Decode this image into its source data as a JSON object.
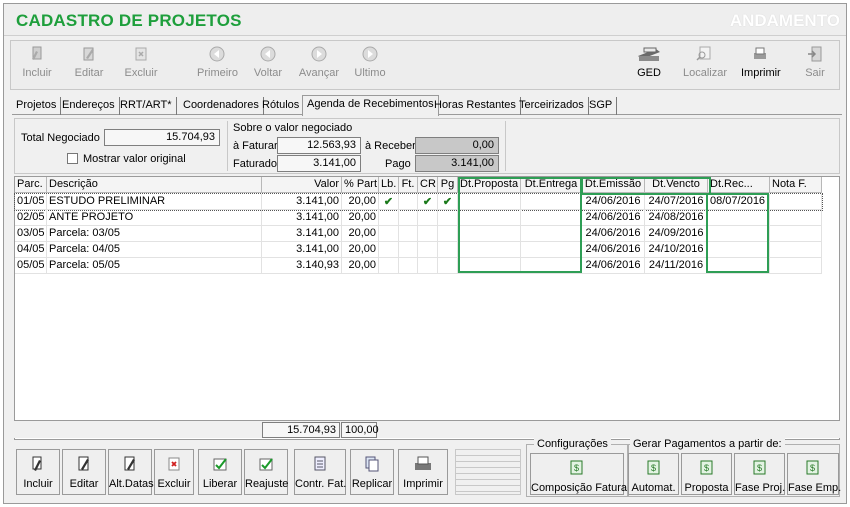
{
  "window": {
    "title": "CADASTRO DE PROJETOS",
    "status": "ANDAMENTO"
  },
  "toolbar": {
    "incluir": "Incluir",
    "editar": "Editar",
    "excluir": "Excluir",
    "primeiro": "Primeiro",
    "voltar": "Voltar",
    "avancar": "Avançar",
    "ultimo": "Ultimo",
    "ged": "GED",
    "localizar": "Localizar",
    "imprimir": "Imprimir",
    "sair": "Sair"
  },
  "tabs": [
    "Projetos",
    "Endereços",
    "RRT/ART*",
    "Coordenadores",
    "Rótulos",
    "Agenda de Recebimentos",
    "Horas Restantes",
    "Terceirizados",
    "SGP"
  ],
  "summary": {
    "total_negociado_label": "Total Negociado",
    "total_negociado": "15.704,93",
    "mostrar_label": "Mostrar valor original",
    "sobre_label": "Sobre o valor negociado",
    "a_faturar_label": "à Faturar",
    "a_faturar": "12.563,93",
    "a_receber_label": "à Receber",
    "a_receber": "0,00",
    "faturado_label": "Faturado",
    "faturado": "3.141,00",
    "pago_label": "Pago",
    "pago": "3.141,00"
  },
  "grid": {
    "headers": {
      "parc": "Parc.",
      "descricao": "Descrição",
      "valor": "Valor",
      "pct": "% Part.",
      "lb": "Lb.",
      "ft": "Ft.",
      "cr": "CR",
      "pg": "Pg",
      "dt_proposta": "Dt.Proposta",
      "dt_entrega": "Dt.Entrega",
      "dt_emissao": "Dt.Emissão",
      "dt_vencto": "Dt.Vencto",
      "dt_rec": "Dt.Rec...",
      "nota": "Nota F."
    },
    "rows": [
      {
        "parc": "01/05",
        "descricao": "ESTUDO PRELIMINAR",
        "valor": "3.141,00",
        "pct": "20,00",
        "lb": "✔",
        "ft": "",
        "cr": "✔",
        "pg": "✔",
        "dt_proposta": "",
        "dt_entrega": "",
        "dt_emissao": "24/06/2016",
        "dt_vencto": "24/07/2016",
        "dt_rec": "08/07/2016",
        "nota": ""
      },
      {
        "parc": "02/05",
        "descricao": "ANTE PROJETO",
        "valor": "3.141,00",
        "pct": "20,00",
        "lb": "",
        "ft": "",
        "cr": "",
        "pg": "",
        "dt_proposta": "",
        "dt_entrega": "",
        "dt_emissao": "24/06/2016",
        "dt_vencto": "24/08/2016",
        "dt_rec": "",
        "nota": ""
      },
      {
        "parc": "03/05",
        "descricao": "Parcela: 03/05",
        "valor": "3.141,00",
        "pct": "20,00",
        "lb": "",
        "ft": "",
        "cr": "",
        "pg": "",
        "dt_proposta": "",
        "dt_entrega": "",
        "dt_emissao": "24/06/2016",
        "dt_vencto": "24/09/2016",
        "dt_rec": "",
        "nota": ""
      },
      {
        "parc": "04/05",
        "descricao": "Parcela: 04/05",
        "valor": "3.141,00",
        "pct": "20,00",
        "lb": "",
        "ft": "",
        "cr": "",
        "pg": "",
        "dt_proposta": "",
        "dt_entrega": "",
        "dt_emissao": "24/06/2016",
        "dt_vencto": "24/10/2016",
        "dt_rec": "",
        "nota": ""
      },
      {
        "parc": "05/05",
        "descricao": "Parcela: 05/05",
        "valor": "3.140,93",
        "pct": "20,00",
        "lb": "",
        "ft": "",
        "cr": "",
        "pg": "",
        "dt_proposta": "",
        "dt_entrega": "",
        "dt_emissao": "24/06/2016",
        "dt_vencto": "24/11/2016",
        "dt_rec": "",
        "nota": ""
      }
    ],
    "total_valor": "15.704,93",
    "total_pct": "100,00"
  },
  "bottom": {
    "incluir": "Incluir",
    "editar": "Editar",
    "alt_datas": "Alt.Datas",
    "excluir": "Excluir",
    "liberar": "Liberar",
    "reajuste": "Reajuste",
    "contr_fat": "Contr. Fat.",
    "replicar": "Replicar",
    "imprimir": "Imprimir",
    "config_title": "Configurações",
    "composicao": "Composição Fatura",
    "gerar_title": "Gerar Pagamentos a partir de:",
    "automat": "Automat.",
    "proposta": "Proposta",
    "fase_proj": "Fase Proj.",
    "fase_emp": "Fase Emp."
  },
  "colors": {
    "title_green": "#1e9f3c",
    "highlight_green": "#2e9e55",
    "check_green": "#1b7a1b"
  },
  "icons": [
    "pencil-icon",
    "eraser-icon",
    "first-icon",
    "back-icon",
    "forward-icon",
    "last-icon",
    "scanner-icon",
    "search-icon",
    "printer-icon",
    "exit-icon",
    "check-icon",
    "money-icon"
  ]
}
